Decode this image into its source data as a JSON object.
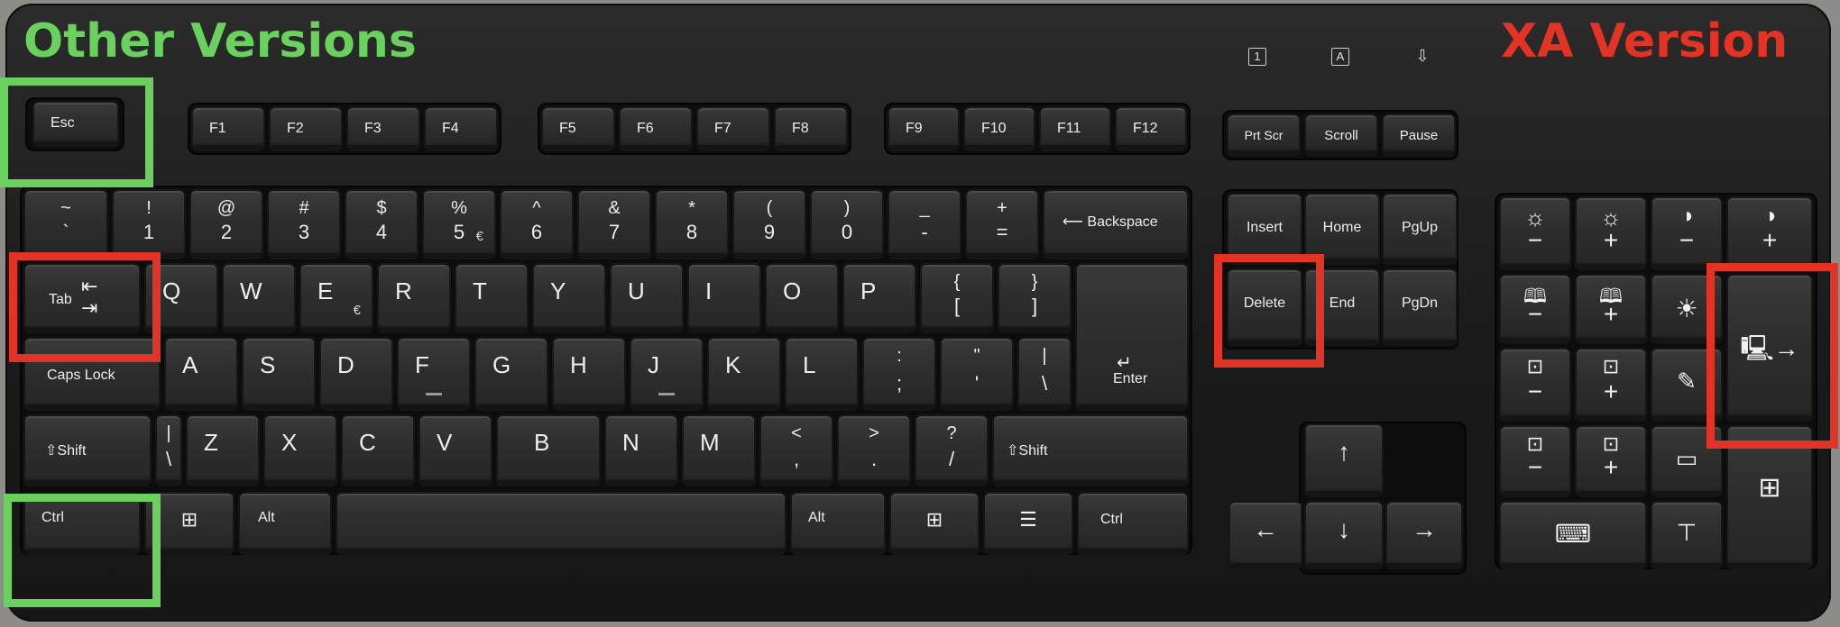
{
  "labels": {
    "other_versions": "Other Versions",
    "xa_version": "XA Version"
  },
  "colors": {
    "other_versions": "#6bd15e",
    "xa_version": "#e23324"
  },
  "indicator_labels": [
    "1",
    "A"
  ],
  "keys": {
    "esc": "Esc",
    "f1": "F1",
    "f2": "F2",
    "f3": "F3",
    "f4": "F4",
    "f5": "F5",
    "f6": "F6",
    "f7": "F7",
    "f8": "F8",
    "f9": "F9",
    "f10": "F10",
    "f11": "F11",
    "f12": "F12",
    "prtscr": "Prt Scr",
    "scroll": "Scroll",
    "pause": "Pause",
    "tilde_top": "~",
    "tilde_bot": "`",
    "n1_top": "!",
    "n1_bot": "1",
    "n2_top": "@",
    "n2_bot": "2",
    "n3_top": "#",
    "n3_bot": "3",
    "n4_top": "$",
    "n4_bot": "4",
    "n5_top": "%",
    "n5_bot": "5",
    "n6_top": "^",
    "n6_bot": "6",
    "n7_top": "&",
    "n7_bot": "7",
    "n8_top": "*",
    "n8_bot": "8",
    "n9_top": "(",
    "n9_bot": "9",
    "n0_top": ")",
    "n0_bot": "0",
    "minus_top": "_",
    "minus_bot": "-",
    "equals_top": "+",
    "equals_bot": "=",
    "euro": "€",
    "backspace": "Backspace",
    "tab": "Tab",
    "q": "Q",
    "w": "W",
    "e": "E",
    "r": "R",
    "t": "T",
    "y": "Y",
    "u": "U",
    "i": "I",
    "o": "O",
    "p": "P",
    "lbracket_top": "{",
    "lbracket_bot": "[",
    "rbracket_top": "}",
    "rbracket_bot": "]",
    "capslock": "Caps Lock",
    "a": "A",
    "s": "S",
    "d": "D",
    "f": "F",
    "g": "G",
    "h": "H",
    "j": "J",
    "k": "K",
    "l": "L",
    "semicolon_top": ":",
    "semicolon_bot": ";",
    "quote_top": "\"",
    "quote_bot": "'",
    "backslash_top": "|",
    "backslash_bot": "\\",
    "enter": "Enter",
    "lshift": "Shift",
    "rshift": "Shift",
    "lt_top": "|",
    "lt_bot": "\\",
    "z": "Z",
    "x": "X",
    "c": "C",
    "v": "V",
    "b": "B",
    "n": "N",
    "m": "M",
    "comma_top": "<",
    "comma_bot": ",",
    "period_top": ">",
    "period_bot": ".",
    "slash_top": "?",
    "slash_bot": "/",
    "lctrl": "Ctrl",
    "lalt": "Alt",
    "ralt": "Alt",
    "rctrl": "Ctrl",
    "insert": "Insert",
    "home": "Home",
    "pgup": "PgUp",
    "delete": "Delete",
    "end": "End",
    "pgdn": "PgDn",
    "minus_sign": "−",
    "plus_sign": "+"
  }
}
